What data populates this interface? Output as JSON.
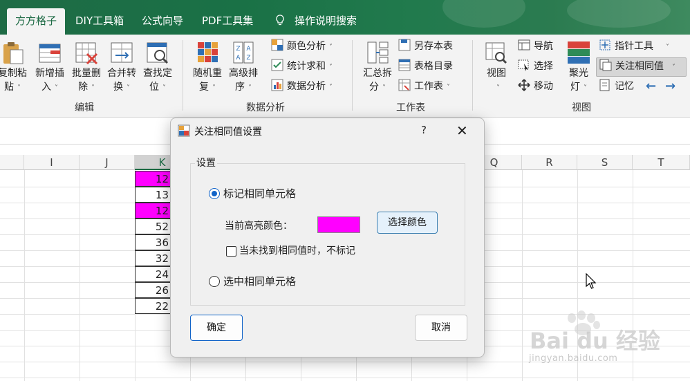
{
  "tabs": [
    {
      "label": "方方格子",
      "active": true
    },
    {
      "label": "DIY工具箱"
    },
    {
      "label": "公式向导"
    },
    {
      "label": "PDF工具集"
    },
    {
      "label": "操作说明搜索",
      "icon": "lightbulb-icon"
    }
  ],
  "ribbon": {
    "edit_group": {
      "label": "编辑",
      "buttons": [
        {
          "label": "复制粘\n贴",
          "icon": "clipboard-icon"
        },
        {
          "label": "新增插\n入",
          "icon": "insert-rows-icon"
        },
        {
          "label": "批量删\n除",
          "icon": "delete-grid-icon"
        },
        {
          "label": "合并转\n换",
          "icon": "merge-convert-icon"
        },
        {
          "label": "查找定\n位",
          "icon": "find-locate-icon"
        }
      ]
    },
    "analysis_group": {
      "label": "数据分析",
      "big_buttons": [
        {
          "label": "随机重\n复",
          "icon": "random-blocks-icon"
        },
        {
          "label": "高级排\n序",
          "icon": "sort-az-icon"
        }
      ],
      "small_buttons": [
        {
          "label": "颜色分析",
          "icon": "color-grid-icon"
        },
        {
          "label": "统计求和",
          "icon": "sum-check-icon"
        },
        {
          "label": "数据分析",
          "icon": "data-analysis-icon"
        }
      ]
    },
    "sheet_group": {
      "label": "工作表",
      "big_button": {
        "label": "汇总拆\n分",
        "icon": "summary-split-icon"
      },
      "small_buttons": [
        {
          "label": "另存本表",
          "icon": "save-sheet-icon"
        },
        {
          "label": "表格目录",
          "icon": "table-catalog-icon"
        },
        {
          "label": "工作表",
          "icon": "worksheet-icon"
        }
      ]
    },
    "view_group": {
      "label": "视图",
      "view_button": {
        "label": "视图",
        "icon": "view-magnifier-icon"
      },
      "small_buttons": [
        {
          "label": "导航",
          "icon": "navigation-icon"
        },
        {
          "label": "选择",
          "icon": "select-icon"
        },
        {
          "label": "移动",
          "icon": "move-icon"
        }
      ],
      "spotlight_button": {
        "label": "聚光\n灯",
        "icon": "spotlight-icon"
      },
      "right_buttons": [
        {
          "label": "指针工具",
          "icon": "pointer-tool-icon"
        },
        {
          "label": "关注相同值",
          "icon": "focus-same-value-icon",
          "active": true
        },
        {
          "label": "记忆",
          "icon": "memory-icon"
        }
      ],
      "nav_arrows": [
        "←",
        "→"
      ]
    }
  },
  "sheet": {
    "columns_left": [
      "I",
      "J",
      "K"
    ],
    "columns_right": [
      "Q",
      "R",
      "S",
      "T"
    ],
    "selected_column": "K",
    "k_values": [
      {
        "value": "12",
        "highlight": true
      },
      {
        "value": "13",
        "highlight": false
      },
      {
        "value": "12",
        "highlight": true
      },
      {
        "value": "52",
        "highlight": false
      },
      {
        "value": "36",
        "highlight": false
      },
      {
        "value": "32",
        "highlight": false
      },
      {
        "value": "24",
        "highlight": false
      },
      {
        "value": "26",
        "highlight": false
      },
      {
        "value": "22",
        "highlight": false
      }
    ],
    "highlight_color": "#ff00ff"
  },
  "dialog": {
    "title": "关注相同值设置",
    "help": "?",
    "close": "✕",
    "group_label": "设置",
    "option_mark": "标记相同单元格",
    "option_mark_selected": true,
    "current_color_label": "当前高亮颜色：",
    "current_color": "#ff00ff",
    "pick_color_button": "选择颜色",
    "no_mark_checkbox": "当未找到相同值时，不标记",
    "no_mark_checked": false,
    "option_select": "选中相同单元格",
    "option_select_selected": false,
    "ok_button": "确定",
    "cancel_button": "取消"
  },
  "watermark": {
    "text": "Bai du 经验",
    "url": "jingyan.baidu.com"
  },
  "colors": {
    "tab_green": "#1e6b45",
    "ribbon_bg": "#f3f3f3",
    "dialog_bg": "#f0f0f0",
    "accent_blue": "#1063c8"
  }
}
